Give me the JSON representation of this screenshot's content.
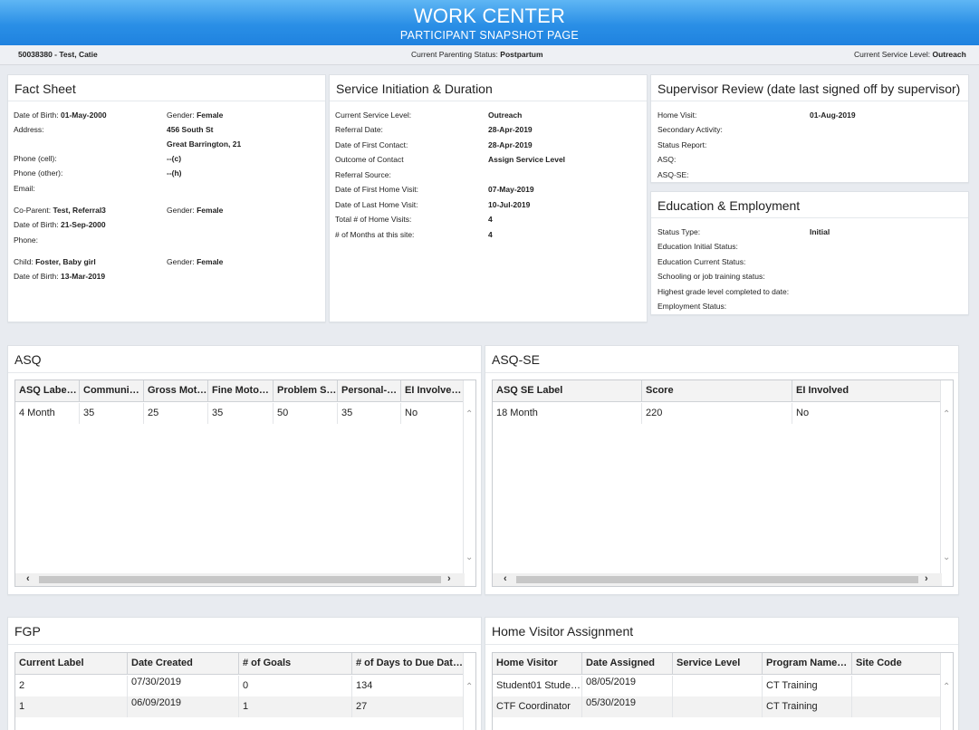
{
  "header": {
    "title": "WORK CENTER",
    "subtitle": "PARTICIPANT SNAPSHOT PAGE"
  },
  "subbar": {
    "participant": "50038380 - Test, Catie",
    "parenting_label": "Current Parenting Status:",
    "parenting_value": "Postpartum",
    "service_label": "Current Service Level:",
    "service_value": "Outreach"
  },
  "fact_sheet": {
    "title": "Fact Sheet",
    "dob_label": "Date of Birth:",
    "dob_value": "01-May-2000",
    "gender_label": "Gender:",
    "gender_value": "Female",
    "address_label": "Address:",
    "address_line1": "456 South St",
    "address_line2": "Great Barrington, 21",
    "phone_cell_label": "Phone (cell):",
    "phone_cell_value": "--(c)",
    "phone_other_label": "Phone (other):",
    "phone_other_value": "--(h)",
    "email_label": "Email:",
    "coparent_label": "Co-Parent:",
    "coparent_value": "Test, Referral3",
    "coparent_gender_label": "Gender:",
    "coparent_gender_value": "Female",
    "coparent_dob_label": "Date of Birth:",
    "coparent_dob_value": "21-Sep-2000",
    "coparent_phone_label": "Phone:",
    "child_label": "Child:",
    "child_value": "Foster, Baby girl",
    "child_gender_label": "Gender:",
    "child_gender_value": "Female",
    "child_dob_label": "Date of Birth:",
    "child_dob_value": "13-Mar-2019"
  },
  "service": {
    "title": "Service Initiation & Duration",
    "rows": [
      {
        "label": "Current Service Level:",
        "value": "Outreach"
      },
      {
        "label": "Referral Date:",
        "value": "28-Apr-2019"
      },
      {
        "label": "Date of First Contact:",
        "value": "28-Apr-2019"
      },
      {
        "label": "Outcome of Contact",
        "value": "Assign Service Level"
      },
      {
        "label": "Referral Source:",
        "value": ""
      },
      {
        "label": "Date of First Home Visit:",
        "value": "07-May-2019"
      },
      {
        "label": "Date of Last Home Visit:",
        "value": "10-Jul-2019"
      },
      {
        "label": "Total # of Home Visits:",
        "value": "4"
      },
      {
        "label": "# of Months at this site:",
        "value": "4"
      }
    ]
  },
  "supervisor": {
    "title": "Supervisor Review (date last signed off by supervisor)",
    "rows": [
      {
        "label": "Home Visit:",
        "value": "01-Aug-2019"
      },
      {
        "label": "Secondary Activity:",
        "value": ""
      },
      {
        "label": "Status Report:",
        "value": ""
      },
      {
        "label": "ASQ:",
        "value": ""
      },
      {
        "label": "ASQ-SE:",
        "value": ""
      }
    ]
  },
  "education": {
    "title": "Education & Employment",
    "rows": [
      {
        "label": "Status Type:",
        "value": "Initial"
      },
      {
        "label": "Education Initial Status:",
        "value": ""
      },
      {
        "label": "Education Current Status:",
        "value": ""
      },
      {
        "label": "Schooling or job training status:",
        "value": ""
      },
      {
        "label": "Highest grade level completed to date:",
        "value": ""
      },
      {
        "label": "Employment Status:",
        "value": ""
      }
    ]
  },
  "asq": {
    "title": "ASQ",
    "headers": [
      "ASQ Labe…",
      "Communi…",
      "Gross Mot…",
      "Fine Moto…",
      "Problem S…",
      "Personal-…",
      "EI Involve…"
    ],
    "rows": [
      [
        "4 Month",
        "35",
        "25",
        "35",
        "50",
        "35",
        "No"
      ]
    ]
  },
  "asqse": {
    "title": "ASQ-SE",
    "headers": [
      "ASQ SE Label",
      "Score",
      "EI Involved"
    ],
    "rows": [
      [
        "18 Month",
        "220",
        "No"
      ]
    ]
  },
  "fgp": {
    "title": "FGP",
    "headers": [
      "Current Label",
      "Date Created",
      "# of Goals",
      "# of Days to Due Dat…"
    ],
    "rows": [
      [
        "2",
        "07/30/2019",
        "0",
        "134"
      ],
      [
        "1",
        "06/09/2019",
        "1",
        "27"
      ]
    ]
  },
  "hva": {
    "title": "Home Visitor Assignment",
    "headers": [
      "Home Visitor",
      "Date Assigned",
      "Service Level",
      "Program Name…",
      "Site Code"
    ],
    "rows": [
      [
        "Student01 Stude…",
        "08/05/2019",
        "",
        "CT Training",
        ""
      ],
      [
        "CTF Coordinator",
        "05/30/2019",
        "",
        "CT Training",
        ""
      ]
    ]
  },
  "icons": {
    "scroll_up": "chevron-up-icon",
    "scroll_down": "chevron-down-icon",
    "scroll_left": "chevron-left-icon",
    "scroll_right": "chevron-right-icon"
  },
  "colors": {
    "header_top": "#5fb6f4",
    "header_bottom": "#1f82df",
    "background": "#e8ebf0"
  }
}
